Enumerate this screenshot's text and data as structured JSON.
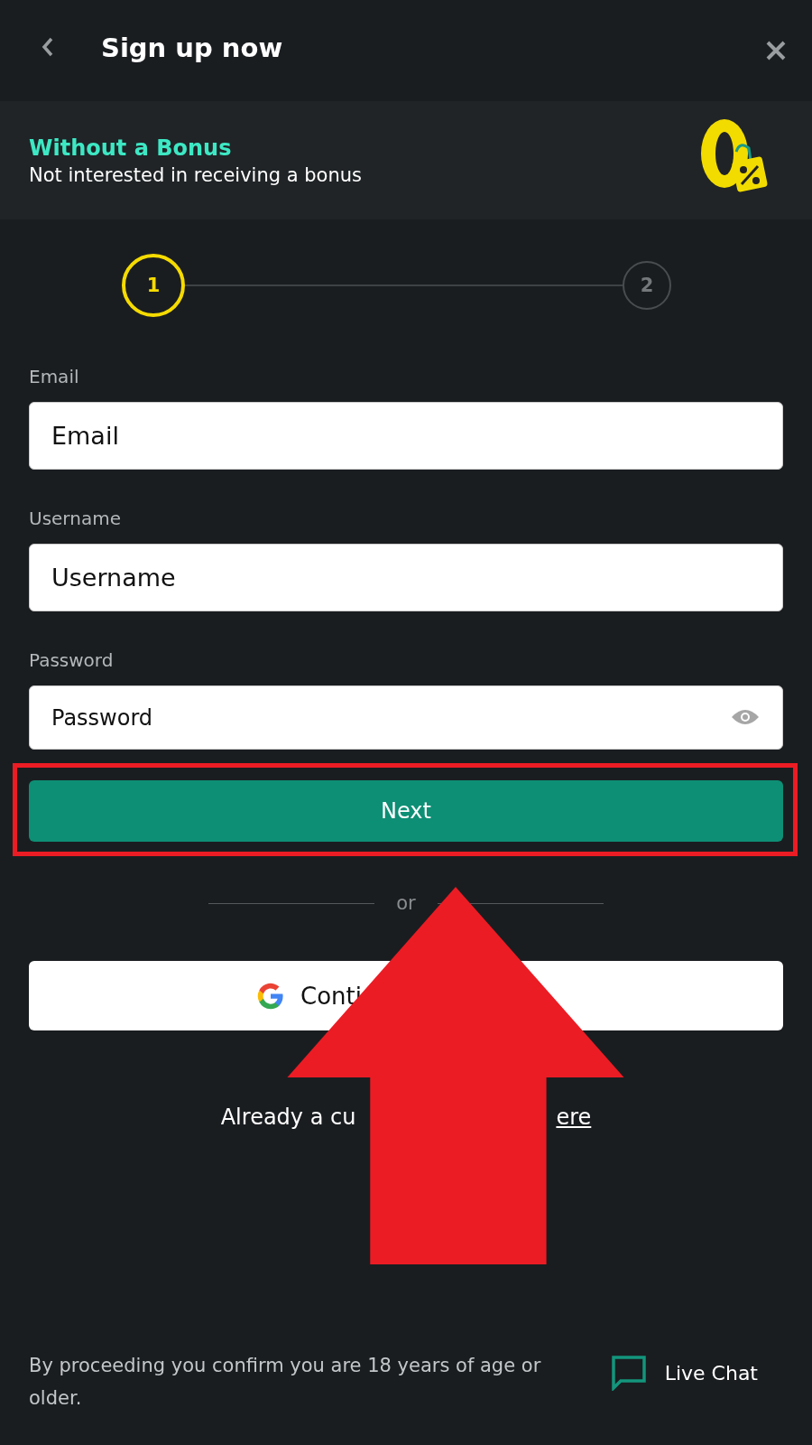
{
  "header": {
    "title": "Sign up now"
  },
  "bonus": {
    "title": "Without a Bonus",
    "subtitle": "Not interested in receiving a bonus"
  },
  "steps": [
    {
      "label": "1",
      "selected": true
    },
    {
      "label": "2",
      "selected": false
    }
  ],
  "fields": [
    {
      "label": "Email",
      "placeholder": "Email",
      "kind": "text"
    },
    {
      "label": "Username",
      "placeholder": "Username",
      "kind": "text"
    },
    {
      "label": "Password",
      "placeholder": "Password",
      "kind": "password"
    }
  ],
  "next_button": "Next",
  "divider": "or",
  "google_button": "Conti",
  "login_prompt": {
    "text": "Already a cu",
    "link": "ere"
  },
  "footer": {
    "notice": "By proceeding you confirm you are 18 years of age or older.",
    "live_chat": "Live Chat"
  }
}
